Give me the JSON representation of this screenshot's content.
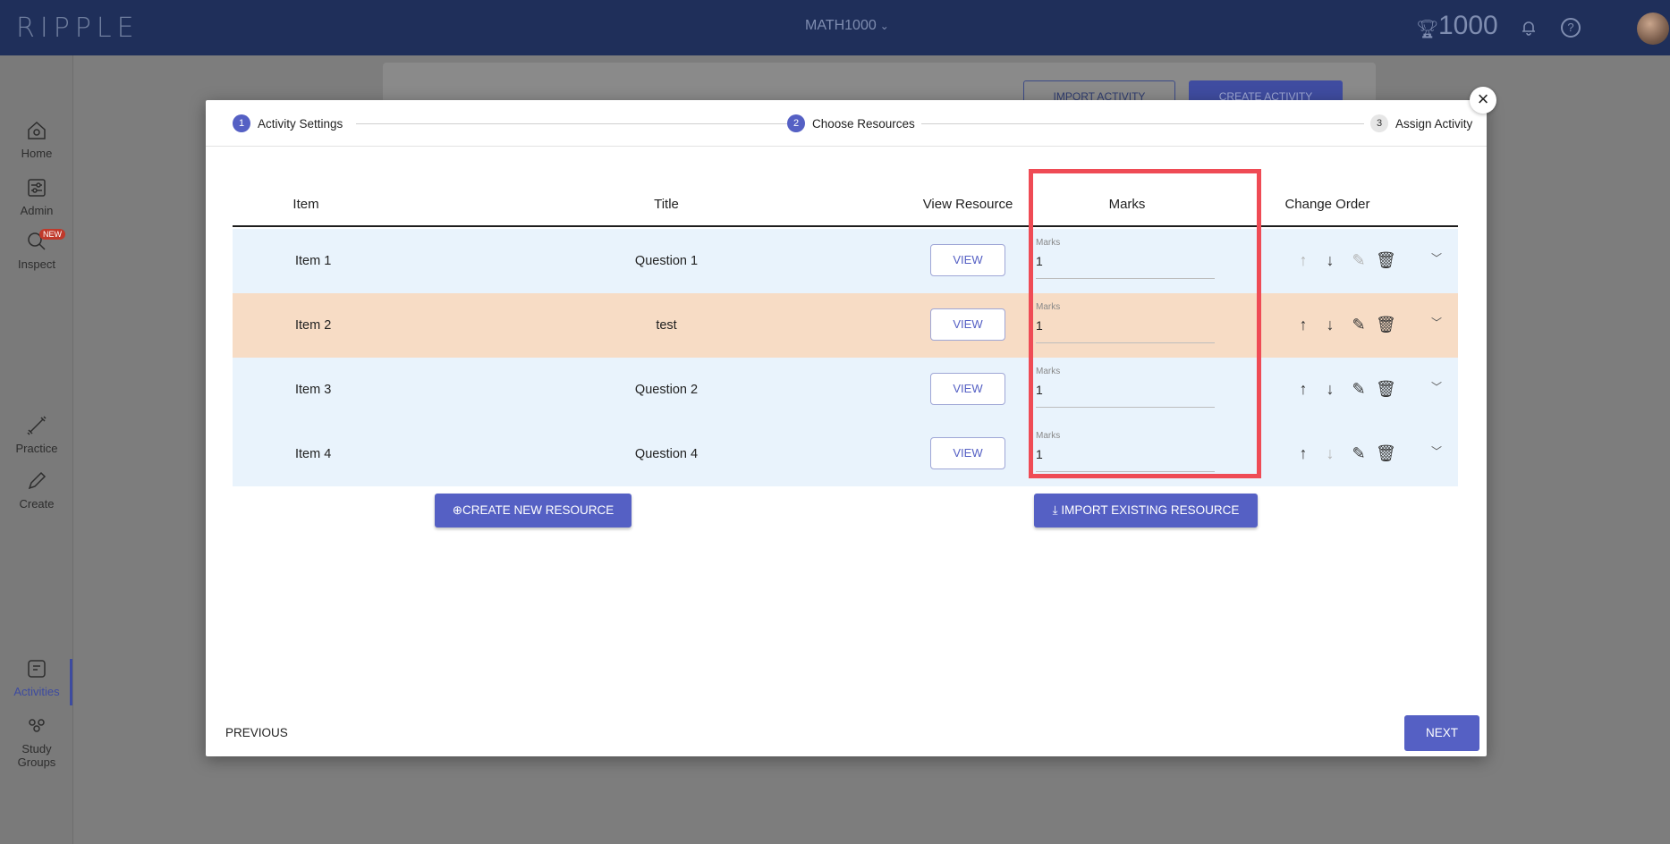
{
  "header": {
    "logo": "RIPPLE",
    "course": "MATH1000",
    "points": "1000"
  },
  "sidebar": {
    "items": [
      {
        "label": "Home",
        "icon": "home-icon"
      },
      {
        "label": "Admin",
        "icon": "admin-icon"
      },
      {
        "label": "Inspect",
        "icon": "inspect-icon",
        "badge": "NEW"
      },
      {
        "label": "Practice",
        "icon": "dumbbell-icon"
      },
      {
        "label": "Create",
        "icon": "pencil-icon"
      },
      {
        "label": "Activities",
        "icon": "activities-icon",
        "active": true
      },
      {
        "label": "Study Groups",
        "icon": "groups-icon"
      }
    ]
  },
  "background": {
    "import_activity": "IMPORT ACTIVITY",
    "create_activity": "CREATE ACTIVITY"
  },
  "modal": {
    "steps": [
      {
        "num": "1",
        "label": "Activity Settings"
      },
      {
        "num": "2",
        "label": "Choose Resources"
      },
      {
        "num": "3",
        "label": "Assign Activity"
      }
    ],
    "columns": {
      "item": "Item",
      "title": "Title",
      "view": "View Resource",
      "marks": "Marks",
      "order": "Change Order"
    },
    "rows": [
      {
        "item": "Item 1",
        "title": "Question 1",
        "view": "VIEW",
        "marks_label": "Marks",
        "marks": "1"
      },
      {
        "item": "Item 2",
        "title": "test",
        "view": "VIEW",
        "marks_label": "Marks",
        "marks": "1"
      },
      {
        "item": "Item 3",
        "title": "Question 2",
        "view": "VIEW",
        "marks_label": "Marks",
        "marks": "1"
      },
      {
        "item": "Item 4",
        "title": "Question 4",
        "view": "VIEW",
        "marks_label": "Marks",
        "marks": "1"
      }
    ],
    "create_resource": "CREATE NEW RESOURCE",
    "import_resource": "IMPORT EXISTING RESOURCE",
    "previous": "PREVIOUS",
    "next": "NEXT"
  },
  "colors": {
    "accent": "#5560c4",
    "highlight": "#ef4b55",
    "row_blue": "#e9f3fc",
    "row_orange": "#f7dcc5"
  }
}
